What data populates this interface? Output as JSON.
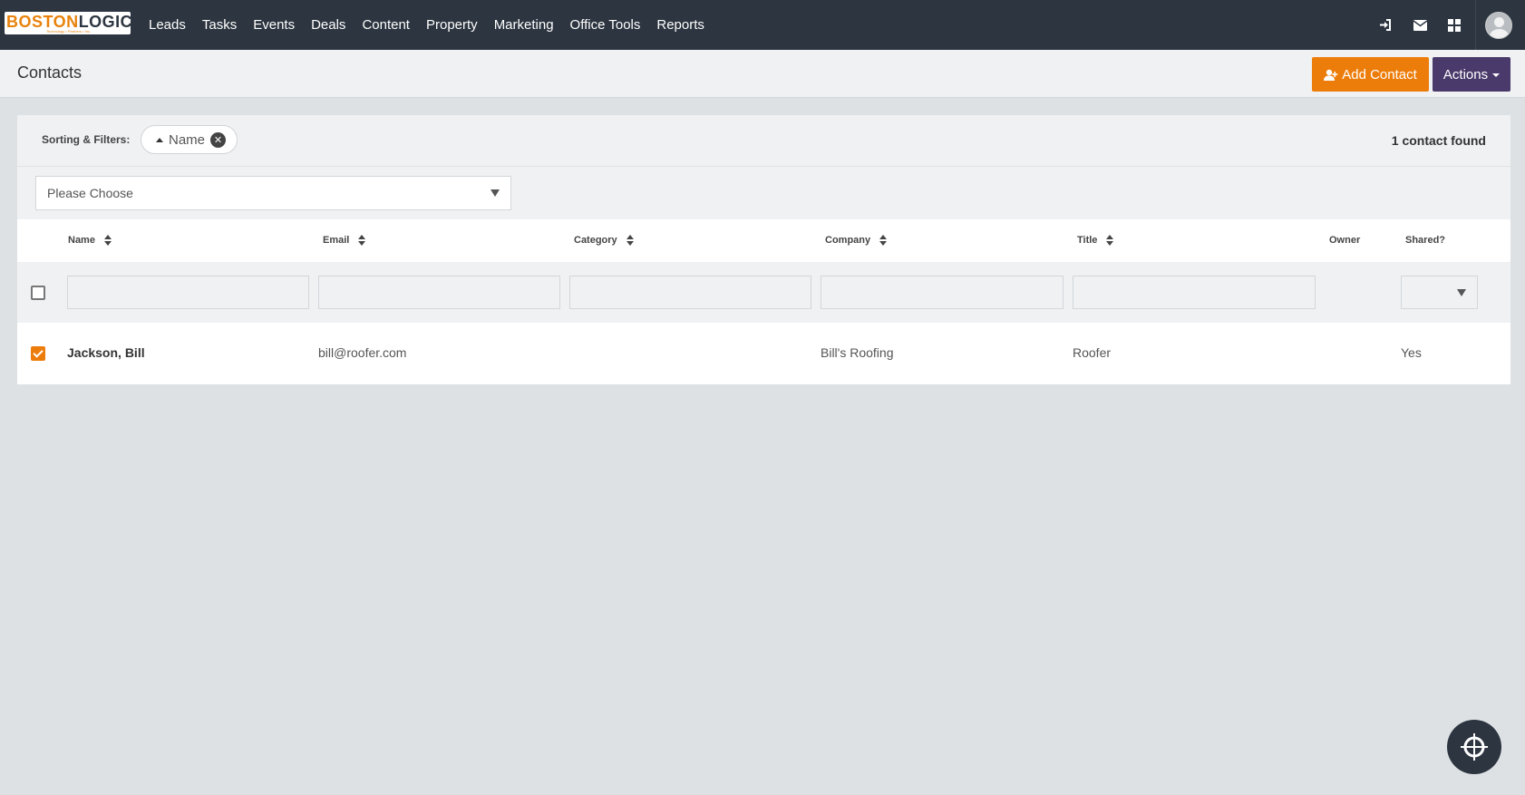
{
  "brand": {
    "logo_part1": "BOSTON",
    "logo_part2": "LOGIC",
    "logo_tagline": "Technology • Partners • Inc.",
    "accent": "#ed7d0b",
    "secondary": "#4a3a6b",
    "nav_bg": "#2c3540"
  },
  "nav": {
    "items": [
      "Leads",
      "Tasks",
      "Events",
      "Deals",
      "Content",
      "Property",
      "Marketing",
      "Office Tools",
      "Reports"
    ],
    "icons": [
      "sign-in-icon",
      "envelope-icon",
      "grid-icon",
      "user-avatar"
    ]
  },
  "header": {
    "title": "Contacts",
    "add_label": "Add Contact",
    "actions_label": "Actions"
  },
  "filters": {
    "label": "Sorting & Filters:",
    "chip_label": "Name",
    "found_text": "1 contact found",
    "select_placeholder": "Please Choose"
  },
  "table": {
    "columns": [
      "Name",
      "Email",
      "Category",
      "Company",
      "Title",
      "Owner",
      "Shared?"
    ],
    "rows": [
      {
        "checked": true,
        "name": "Jackson, Bill",
        "email": "bill@roofer.com",
        "category": "",
        "company": "Bill's Roofing",
        "title": "Roofer",
        "owner": "",
        "shared": "Yes"
      }
    ]
  }
}
